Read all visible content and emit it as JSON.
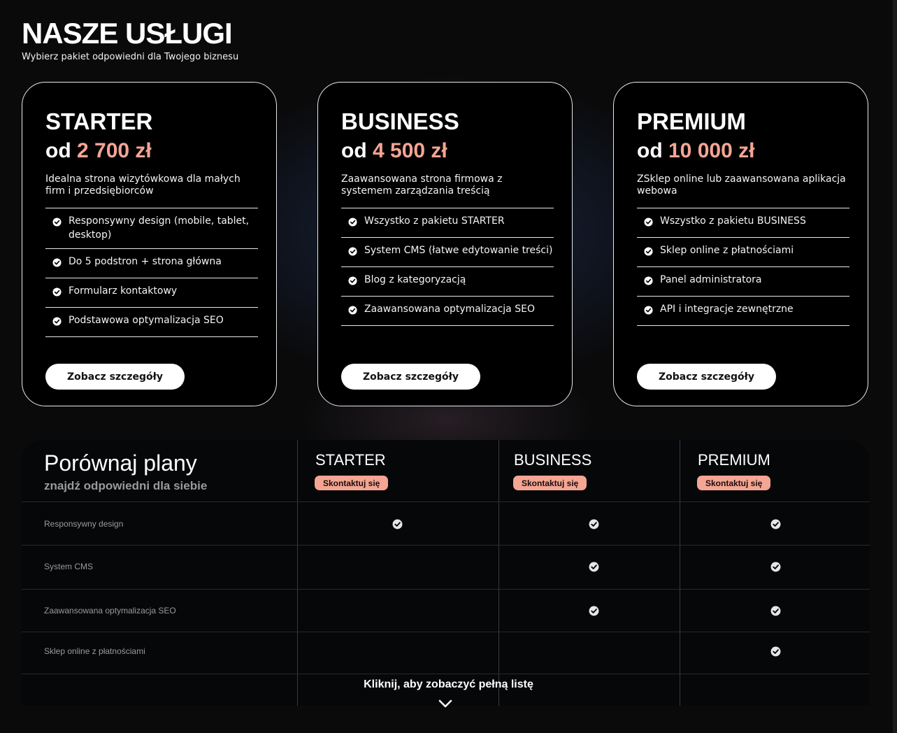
{
  "header": {
    "title": "NASZE USŁUGI",
    "subtitle": "Wybierz pakiet odpowiedni dla Twojego biznesu"
  },
  "plans": [
    {
      "name": "STARTER",
      "price_prefix": "od",
      "price": "2 700 zł",
      "description": "Idealna strona wizytówkowa dla małych firm i przedsiębiorców",
      "features": [
        "Responsywny design (mobile, tablet, desktop)",
        "Do 5 podstron + strona główna",
        "Formularz kontaktowy",
        "Podstawowa optymalizacja SEO"
      ],
      "button": "Zobacz szczegóły"
    },
    {
      "name": "BUSINESS",
      "price_prefix": "od",
      "price": "4 500 zł",
      "description": "Zaawansowana strona firmowa z systemem zarządzania treścią",
      "features": [
        "Wszystko z pakietu STARTER",
        "System CMS (łatwe edytowanie treści)",
        "Blog z kategoryzacją",
        "Zaawansowana optymalizacja SEO"
      ],
      "button": "Zobacz szczegóły"
    },
    {
      "name": "PREMIUM",
      "price_prefix": "od",
      "price": "10 000 zł",
      "description": "ZSklep online lub zaawansowana aplikacja webowa",
      "features": [
        "Wszystko z pakietu BUSINESS",
        "Sklep online z płatnościami",
        "Panel administratora",
        "API i integracje zewnętrzne"
      ],
      "button": "Zobacz szczegóły"
    }
  ],
  "compare": {
    "title": "Porównaj plany",
    "subtitle": "znajdź odpowiedni dla siebie",
    "columns": [
      {
        "name": "STARTER",
        "button": "Skontaktuj się"
      },
      {
        "name": "BUSINESS",
        "button": "Skontaktuj się"
      },
      {
        "name": "PREMIUM",
        "button": "Skontaktuj się"
      }
    ],
    "rows": [
      {
        "label": "Responsywny design",
        "included": [
          true,
          true,
          true
        ]
      },
      {
        "label": "System CMS",
        "included": [
          false,
          true,
          true
        ]
      },
      {
        "label": "Zaawansowana optymalizacja SEO",
        "included": [
          false,
          true,
          true
        ]
      },
      {
        "label": "Sklep online z płatnościami",
        "included": [
          false,
          false,
          true
        ]
      }
    ],
    "more_link": "Kliknij, aby zobaczyć pełną listę"
  },
  "icons": {
    "check": "check-circle-icon",
    "more": "chevron-down-icon"
  },
  "colors": {
    "accent": "#f4a593",
    "background": "#0a0a0b",
    "card_bg": "#000000"
  }
}
